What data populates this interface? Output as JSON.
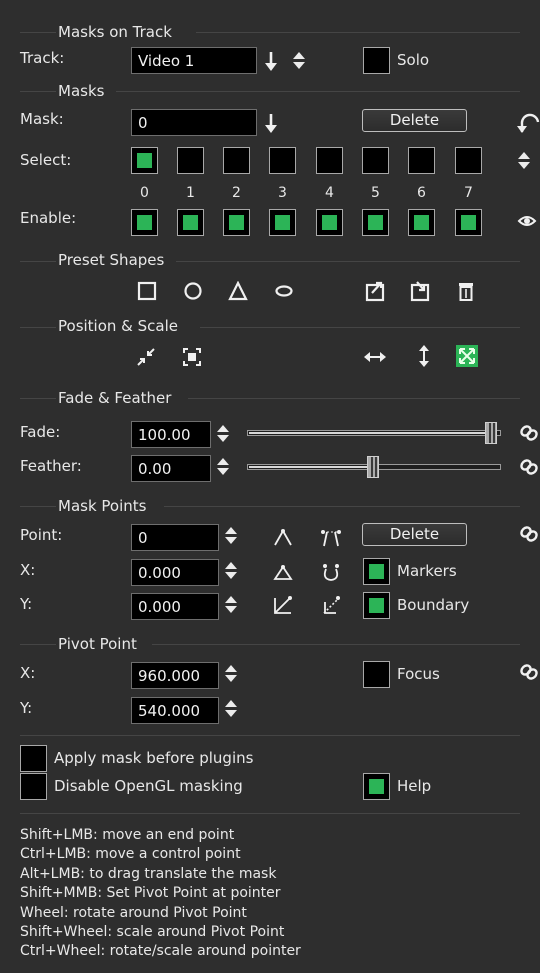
{
  "masks_on_track": {
    "section_title": "Masks on Track",
    "track_label": "Track:",
    "track_value": "Video 1",
    "solo_label": "Solo",
    "solo_checked": false
  },
  "masks": {
    "section_title": "Masks",
    "mask_label": "Mask:",
    "mask_value": "0",
    "delete_label": "Delete",
    "select_label": "Select:",
    "enable_label": "Enable:",
    "numbers": [
      "0",
      "1",
      "2",
      "3",
      "4",
      "5",
      "6",
      "7"
    ],
    "select_checked": [
      true,
      false,
      false,
      false,
      false,
      false,
      false,
      false
    ],
    "enable_checked": [
      true,
      true,
      true,
      true,
      true,
      true,
      true,
      true
    ]
  },
  "preset_shapes": {
    "section_title": "Preset Shapes"
  },
  "position_scale": {
    "section_title": "Position & Scale"
  },
  "fade_feather": {
    "section_title": "Fade & Feather",
    "fade_label": "Fade:",
    "fade_value": "100.00",
    "fade_fraction": 1.0,
    "feather_label": "Feather:",
    "feather_value": "0.00",
    "feather_fraction": 0.5
  },
  "mask_points": {
    "section_title": "Mask Points",
    "point_label": "Point:",
    "point_value": "0",
    "delete_label": "Delete",
    "x_label": "X:",
    "x_value": "0.000",
    "y_label": "Y:",
    "y_value": "0.000",
    "markers_label": "Markers",
    "markers_checked": true,
    "boundary_label": "Boundary",
    "boundary_checked": true
  },
  "pivot_point": {
    "section_title": "Pivot Point",
    "x_label": "X:",
    "x_value": "960.000",
    "y_label": "Y:",
    "y_value": "540.000",
    "focus_label": "Focus",
    "focus_checked": false
  },
  "options": {
    "apply_before_plugins_label": "Apply mask before plugins",
    "apply_before_plugins_checked": false,
    "disable_opengl_label": "Disable OpenGL masking",
    "disable_opengl_checked": false,
    "help_label": "Help",
    "help_checked": true
  },
  "help_text": [
    "Shift+LMB: move an end point",
    "Ctrl+LMB: move a control point",
    "Alt+LMB: to drag translate the mask",
    "Shift+MMB: Set Pivot Point at pointer",
    "Wheel: rotate around Pivot Point",
    "Shift+Wheel: scale around Pivot Point",
    "Ctrl+Wheel: rotate/scale around pointer"
  ],
  "colors": {
    "background": "#2e2e2e",
    "check_green": "#2cb457",
    "field_bg": "#000000"
  }
}
